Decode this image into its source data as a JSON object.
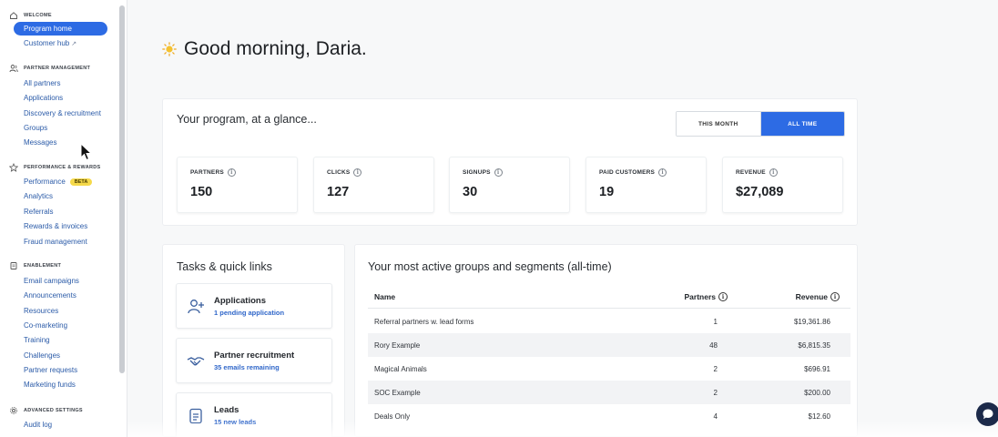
{
  "sidebar": {
    "sections": [
      {
        "title": "WELCOME",
        "icon": "home-icon",
        "items": [
          "Program home",
          "Customer hub"
        ]
      },
      {
        "title": "PARTNER MANAGEMENT",
        "icon": "users-icon",
        "items": [
          "All partners",
          "Applications",
          "Discovery & recruitment",
          "Groups",
          "Messages"
        ]
      },
      {
        "title": "PERFORMANCE & REWARDS",
        "icon": "star-icon",
        "items": [
          "Performance",
          "Analytics",
          "Referrals",
          "Rewards & invoices",
          "Fraud management"
        ]
      },
      {
        "title": "ENABLEMENT",
        "icon": "book-icon",
        "items": [
          "Email campaigns",
          "Announcements",
          "Resources",
          "Co-marketing",
          "Training",
          "Challenges",
          "Partner requests",
          "Marketing funds"
        ]
      },
      {
        "title": "ADVANCED SETTINGS",
        "icon": "gear-icon",
        "items": [
          "Audit log"
        ]
      }
    ],
    "active_item": "Program home",
    "beta_badge": "BETA"
  },
  "greeting": "Good morning, Daria.",
  "glance": {
    "title": "Your program, at a glance...",
    "toggle": {
      "this_month": "THIS MONTH",
      "all_time": "ALL TIME",
      "selected": "ALL TIME"
    },
    "stats": [
      {
        "label": "PARTNERS",
        "value": "150"
      },
      {
        "label": "CLICKS",
        "value": "127"
      },
      {
        "label": "SIGNUPS",
        "value": "30"
      },
      {
        "label": "PAID CUSTOMERS",
        "value": "19"
      },
      {
        "label": "REVENUE",
        "value": "$27,089"
      }
    ]
  },
  "tasks": {
    "title": "Tasks & quick links",
    "items": [
      {
        "title": "Applications",
        "sub": "1 pending application",
        "icon": "add-user-icon"
      },
      {
        "title": "Partner recruitment",
        "sub": "35 emails remaining",
        "icon": "handshake-icon"
      },
      {
        "title": "Leads",
        "sub": "15 new leads",
        "icon": "document-icon"
      }
    ]
  },
  "groups": {
    "title": "Your most active groups and segments (all-time)",
    "columns": {
      "name": "Name",
      "partners": "Partners",
      "revenue": "Revenue"
    },
    "rows": [
      {
        "name": "Referral partners w. lead forms",
        "partners": "1",
        "revenue": "$19,361.86"
      },
      {
        "name": "Rory Example",
        "partners": "48",
        "revenue": "$6,815.35"
      },
      {
        "name": "Magical Animals",
        "partners": "2",
        "revenue": "$696.91"
      },
      {
        "name": "SOC Example",
        "partners": "2",
        "revenue": "$200.00"
      },
      {
        "name": "Deals Only",
        "partners": "4",
        "revenue": "$12.60"
      }
    ]
  },
  "colors": {
    "accent": "#2d6be4",
    "link": "#2b5ba8",
    "beta": "#f5d94a",
    "chat": "#1c2a4a"
  }
}
